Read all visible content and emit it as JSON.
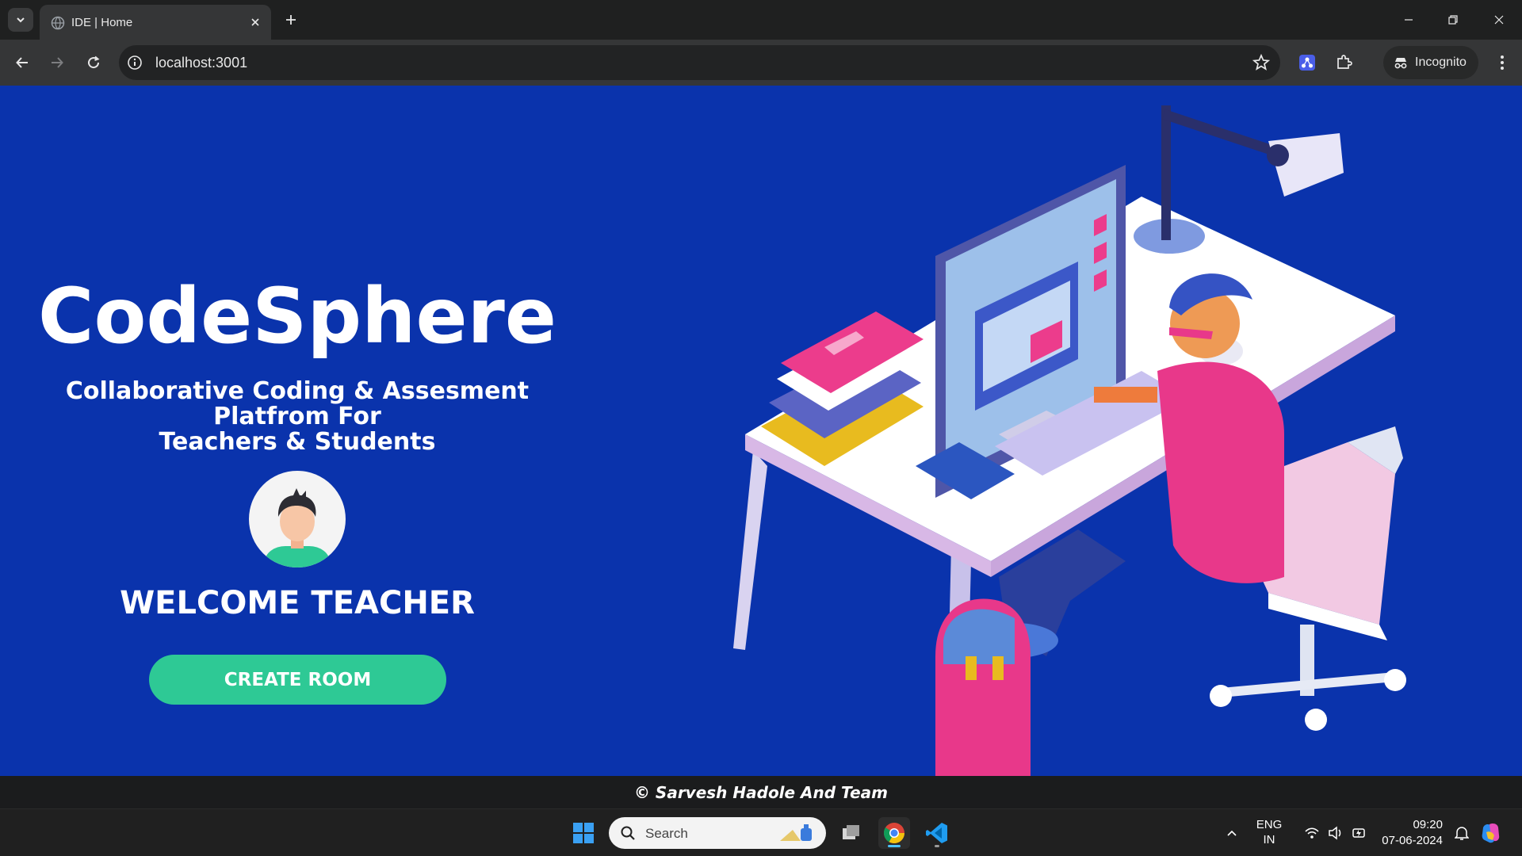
{
  "browser": {
    "tab_title": "IDE | Home",
    "url": "localhost:3001",
    "incognito_label": "Incognito"
  },
  "page": {
    "brand": "CodeSphere",
    "tagline_lines": [
      "Collaborative Coding & Assesment",
      "Platfrom For",
      "Teachers & Students"
    ],
    "welcome": "WELCOME TEACHER",
    "cta_label": "CREATE ROOM",
    "footer": "© Sarvesh Hadole And Team",
    "colors": {
      "background": "#0a33ac",
      "cta": "#2ec995",
      "footer": "#1b1c1d"
    }
  },
  "taskbar": {
    "search_label": "Search",
    "language": "ENG",
    "region": "IN",
    "time": "09:20",
    "date": "07-06-2024"
  }
}
